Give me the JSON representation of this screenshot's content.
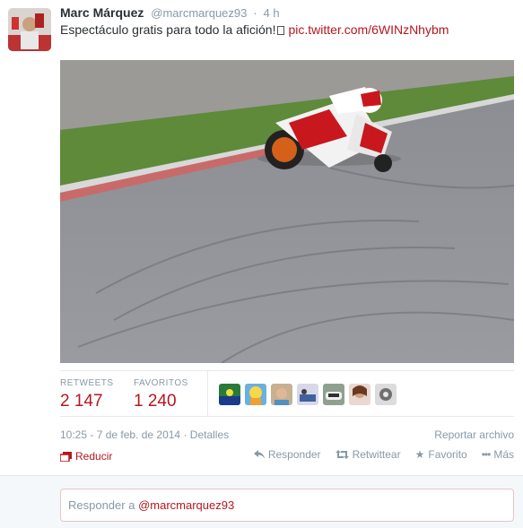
{
  "tweet": {
    "fullname": "Marc Márquez",
    "username": "@marcmarquez93",
    "dot": "·",
    "time": "4 h",
    "text": "Espectáculo gratis para todo la afición!",
    "link": "pic.twitter.com/6WINzNhybm"
  },
  "stats": {
    "retweets_label": "RETWEETS",
    "retweets_value": "2 147",
    "favorites_label": "FAVORITOS",
    "favorites_value": "1 240"
  },
  "meta": {
    "timestamp": "10:25 - 7 de feb. de 2014",
    "sep": "·",
    "details": "Detalles",
    "report": "Reportar archivo"
  },
  "actions": {
    "collapse": "Reducir",
    "reply": "Responder",
    "retweet": "Retwittear",
    "favorite": "Favorito",
    "more": "Más"
  },
  "reply": {
    "prefix": "Responder a",
    "mention": "@marcmarquez93"
  },
  "colors": {
    "accent": "#b5171f",
    "muted": "#8899a6"
  },
  "icons": [
    "reply-icon",
    "retweet-icon",
    "star-icon",
    "more-icon",
    "collapse-icon"
  ]
}
